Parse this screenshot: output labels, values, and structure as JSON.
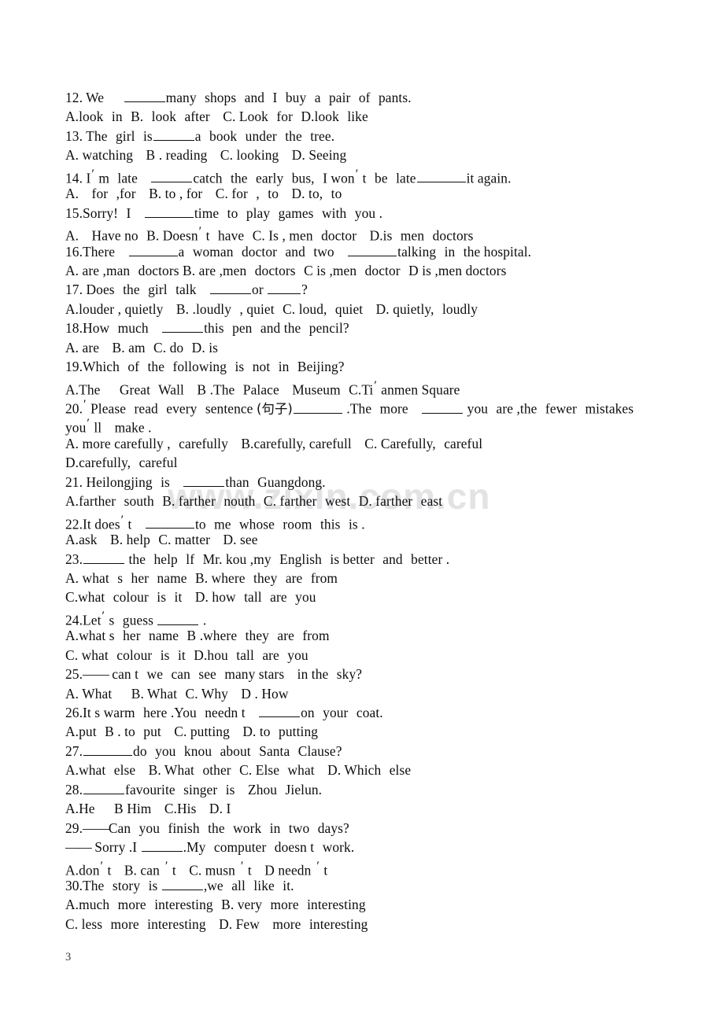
{
  "document": {
    "type": "english-exam-multiple-choice",
    "page_number": "3",
    "watermark": "www.zixin.com.cn",
    "watermark_color": "#e3e3e6",
    "text_color": "#0d0d0d"
  },
  "lines": [
    {
      "id": "q12-stem",
      "text": "12. We ____ many shops and I buy a pair of pants."
    },
    {
      "id": "q12-options",
      "text": "A.look  in  B.  look  after   C. Look   for  D.look   like"
    },
    {
      "id": "q13-stem",
      "text": "13. The  girl  is ____ a  book  under  the  tree."
    },
    {
      "id": "q13-options",
      "text": "A. watching   B . reading   C. looking   D. Seeing"
    },
    {
      "id": "q14-stem",
      "text": "14. I ′ m  late  ____ catch  the  early  bus,  I won ′ t  be  late ____ it again."
    },
    {
      "id": "q14-options",
      "text": "A.   for  ,for   B. to , for   C. for  ,  to   D. to,  to"
    },
    {
      "id": "q15-stem",
      "text": "15.Sorry!  I  ____ time  to  play  games  with  you ."
    },
    {
      "id": "q15-options",
      "text": "A.  Have no  B. Doesn ′ t  have  C. Is , men  doctor   D.is  men  doctors"
    },
    {
      "id": "q16-stem",
      "text": "16.There  ____ a  woman  doctor  and  two  ____ talking  in  the hospital."
    },
    {
      "id": "q16-options",
      "text": "A. are ,man  doctors B. are ,men  doctors  C is ,men  doctor  D is ,men doctors"
    },
    {
      "id": "q17-stem",
      "text": "17. Does  the  girl  talk  ____ or ____ ?"
    },
    {
      "id": "q17-options",
      "text": "A.louder , quietly   B. .loudly  , quiet  C. loud,  quiet   D. quietly,  loudly"
    },
    {
      "id": "q18-stem",
      "text": "18.How  much  ____ this  pen  and the  pencil?"
    },
    {
      "id": "q18-options",
      "text": "A. are   B. am  C. do  D. is"
    },
    {
      "id": "q19-stem",
      "text": "19.Which  of  the  following  is  not  in  Beijing?"
    },
    {
      "id": "q19-options",
      "text": "A.The   Great  Wall   B .The  Palace   Museum  C.Ti ′ anmen Square"
    },
    {
      "id": "q20-stem",
      "text": "20. ′ Please  read  every  sentence (句子)____ .The  more  ____ you  are ,the  fewer  mistakes"
    },
    {
      "id": "q20-stem2",
      "text": "you ′ ll   make ."
    },
    {
      "id": "q20-options",
      "text": "A. more carefully ,  carefully   B.carefully, carefull   C. Carefully,  careful"
    },
    {
      "id": "q20-options2",
      "text": "D.carefully,  careful"
    },
    {
      "id": "q21-stem",
      "text": "21. Heilongjing  is  ____ than  Guangdong."
    },
    {
      "id": "q21-options",
      "text": "A.farther  south  B. farther  nouth  C. farther  west  D. farther  east"
    },
    {
      "id": "q22-stem",
      "text": "22.It does ′ t  ____ to  me  whose  room  this  is ."
    },
    {
      "id": "q22-options",
      "text": "A.ask   B. help  C. matter   D. see"
    },
    {
      "id": "q23-stem",
      "text": "23.____ the  help  lf  Mr. kou ,my  English  is better  and  better ."
    },
    {
      "id": "q23-options",
      "text": "A. what  s  her  name  B. where  they  are  from"
    },
    {
      "id": "q23-options2",
      "text": "C.what  colour  is  it   D. how  tall  are  you"
    },
    {
      "id": "q24-stem",
      "text": "24.Let ′ s  guess ____ ."
    },
    {
      "id": "q24-options",
      "text": "A.what s  her  name  B .where  they  are  from"
    },
    {
      "id": "q24-options2",
      "text": "C. what  colour  is  it  D.hou  tall  are  you"
    },
    {
      "id": "q25-stem",
      "text": "25.—— can t  we  can  see  many stars   in the  sky?"
    },
    {
      "id": "q25-options",
      "text": "A. What    B. What  C. Why   D . How"
    },
    {
      "id": "q26-stem",
      "text": "26.It s warm  here .You  needn t  ____ on  your  coat."
    },
    {
      "id": "q26-options",
      "text": "A.put  B . to  put   C. putting   D. to  putting"
    },
    {
      "id": "q27-stem",
      "text": "27.____ do  you  knou  about  Santa  Clause?"
    },
    {
      "id": "q27-options",
      "text": "A.what  else   B. What  other  C. Else  what   D. Which  else"
    },
    {
      "id": "q28-stem",
      "text": "28.____ favourite  singer  is  Zhou  Jielun."
    },
    {
      "id": "q28-options",
      "text": "A.He   B Him   C.His   D. I"
    },
    {
      "id": "q29-stem",
      "text": "29.——Can  you  finish  the  work  in  two  days?"
    },
    {
      "id": "q29-stem2",
      "text": "—— Sorry .I ____.My  computer  doesn t  work."
    },
    {
      "id": "q29-options",
      "text": "A.don ′ t  B. can ′ t  C. musn ′ t  D needn ′ t"
    },
    {
      "id": "q30-stem",
      "text": "30.The  story  is ____ ,we  all  like  it."
    },
    {
      "id": "q30-options",
      "text": "A.much  more  interesting  B. very  more  interesting"
    },
    {
      "id": "q30-options2",
      "text": "C. less  more  interesting   D. Few  more  interesting"
    }
  ]
}
